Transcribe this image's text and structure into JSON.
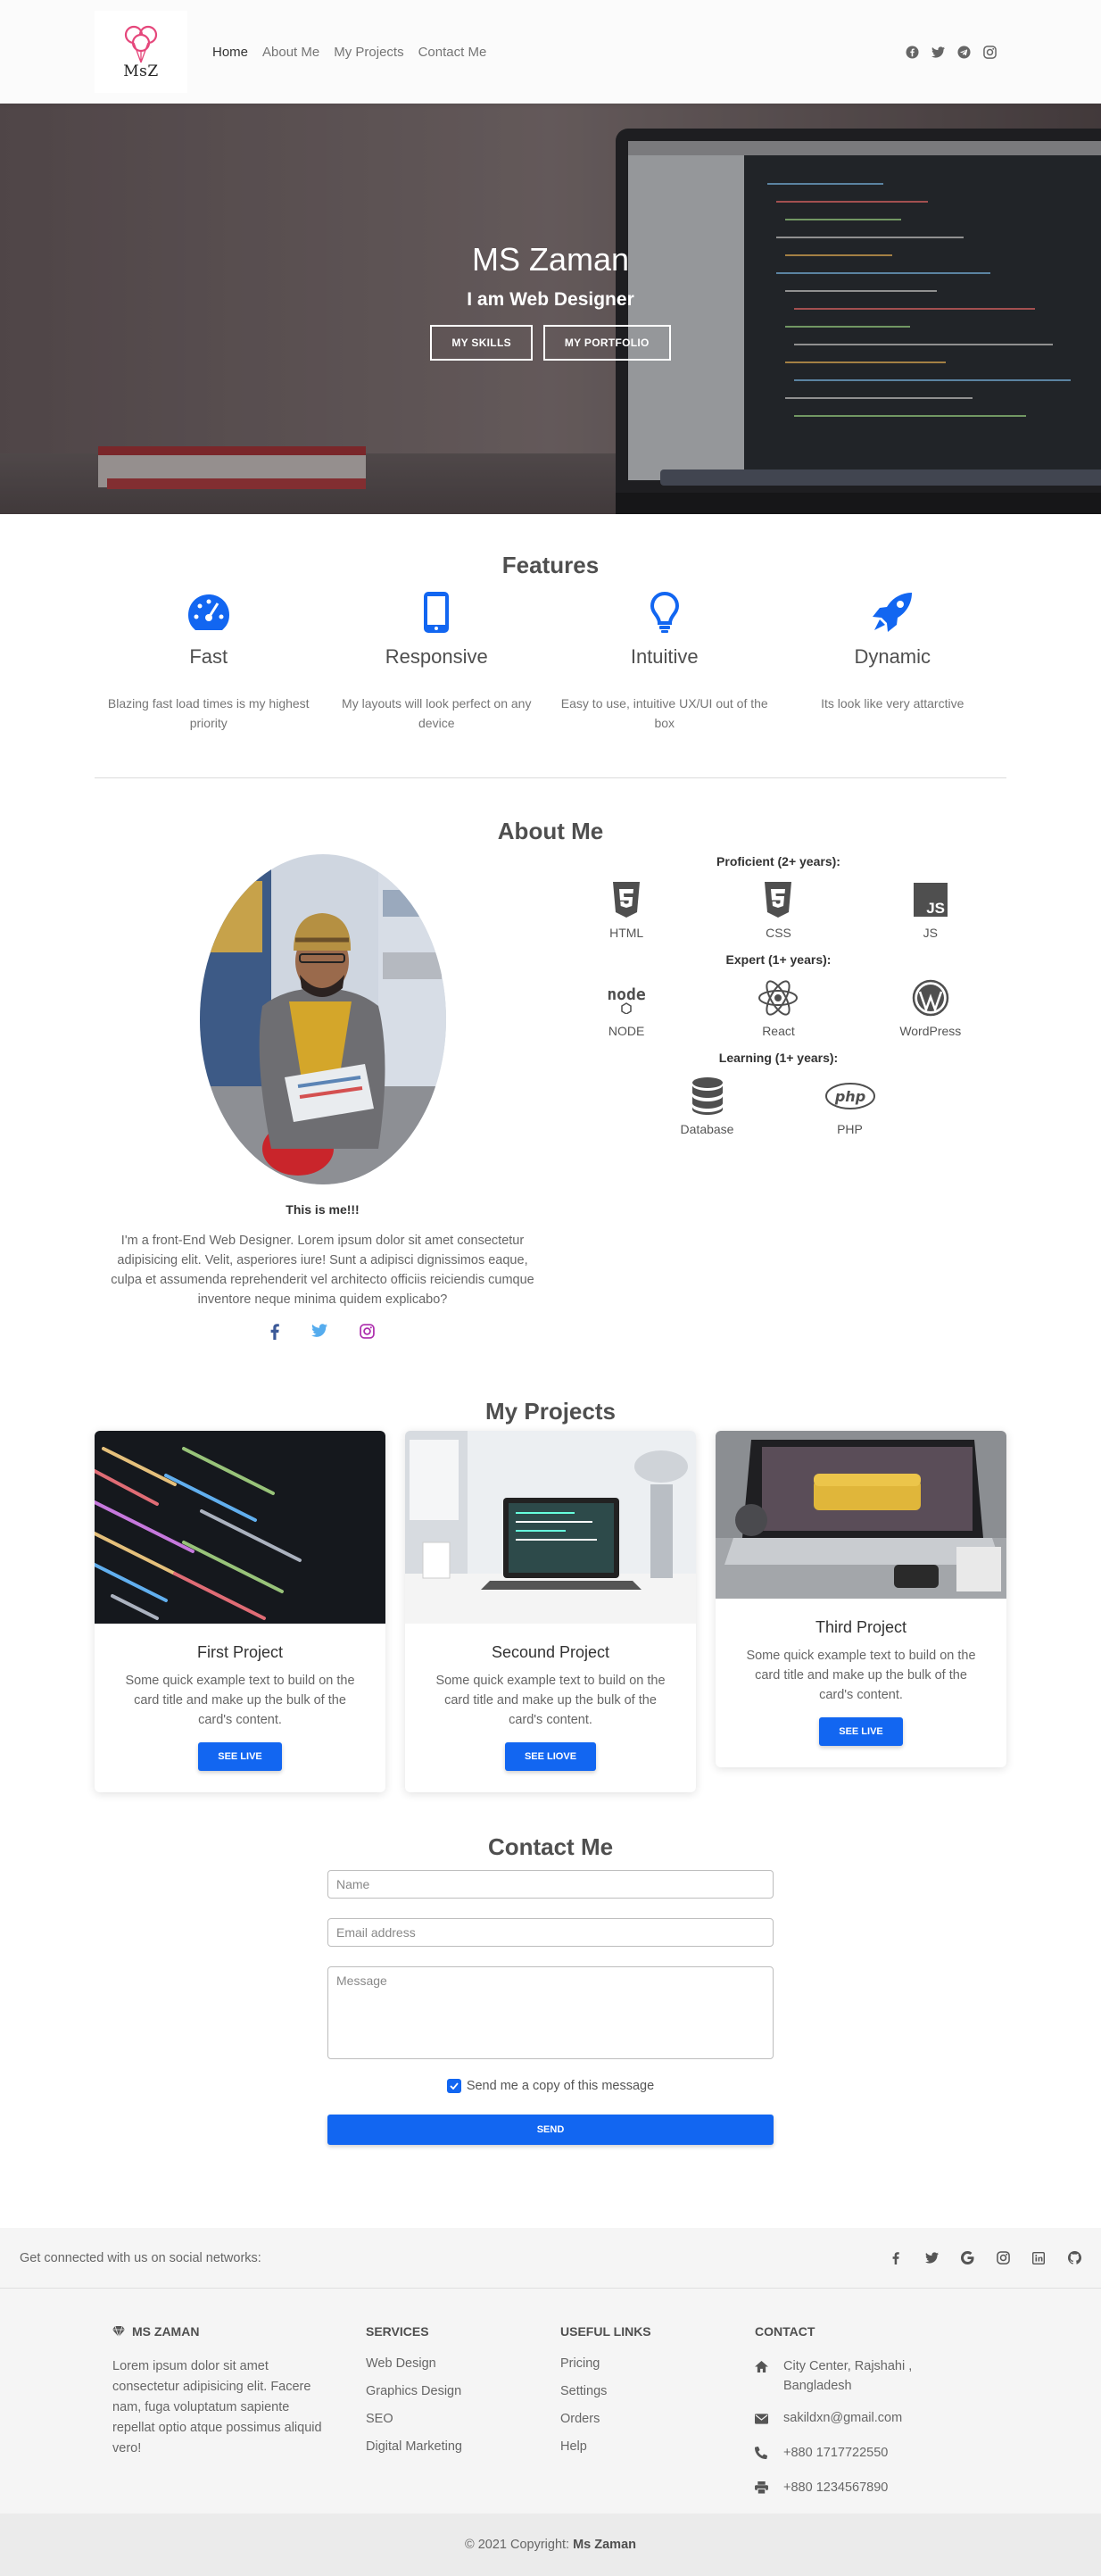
{
  "nav": {
    "logo_text": "MsZ",
    "links": [
      "Home",
      "About Me",
      "My Projects",
      "Contact Me"
    ],
    "social_icons": [
      "facebook-icon",
      "twitter-icon",
      "telegram-icon",
      "instagram-icon"
    ]
  },
  "hero": {
    "title": "MS Zaman",
    "subtitle": "I am Web Designer",
    "btn_skills": "MY SKILLS",
    "btn_portfolio": "MY PORTFOLIO"
  },
  "features": {
    "title": "Features",
    "items": [
      {
        "icon": "speedometer-icon",
        "title": "Fast",
        "text": "Blazing fast load times is my highest priority"
      },
      {
        "icon": "mobile-icon",
        "title": "Responsive",
        "text": "My layouts will look perfect on any device"
      },
      {
        "icon": "lightbulb-icon",
        "title": "Intuitive",
        "text": "Easy to use, intuitive UX/UI out of the box"
      },
      {
        "icon": "rocket-icon",
        "title": "Dynamic",
        "text": "Its look like very attarctive"
      }
    ]
  },
  "about": {
    "title": "About Me",
    "caption": "This is me!!!",
    "text": "I'm a front-End Web Designer. Lorem ipsum dolor sit amet consectetur adipisicing elit. Velit, asperiores iure! Sunt a adipisci dignissimos eaque, culpa et assumenda reprehenderit vel architecto officiis reiciendis cumque inventore neque minima quidem explicabo?",
    "social_icons": [
      "facebook-icon",
      "twitter-icon",
      "instagram-icon"
    ],
    "groups": [
      {
        "label": "Proficient (2+ years):",
        "skills": [
          "HTML",
          "CSS",
          "JS"
        ]
      },
      {
        "label": "Expert (1+ years):",
        "skills": [
          "NODE",
          "React",
          "WordPress"
        ]
      },
      {
        "label": "Learning (1+ years):",
        "skills": [
          "Database",
          "PHP"
        ]
      }
    ]
  },
  "projects": {
    "title": "My Projects",
    "cards": [
      {
        "title": "First Project",
        "text": "Some quick example text to build on the card title and make up the bulk of the card's content.",
        "button": "SEE LIVE"
      },
      {
        "title": "Secound Project",
        "text": "Some quick example text to build on the card title and make up the bulk of the card's content.",
        "button": "SEE LIOVE"
      },
      {
        "title": "Third Project",
        "text": "Some quick example text to build on the card title and make up the bulk of the card's content.",
        "button": "SEE LIVE"
      }
    ]
  },
  "contact": {
    "title": "Contact Me",
    "name_placeholder": "Name",
    "email_placeholder": "Email address",
    "message_placeholder": "Message",
    "copy_label": "Send me a copy of this message",
    "send": "SEND"
  },
  "footer": {
    "social_label": "Get connected with us on social networks:",
    "social_icons": [
      "facebook-icon",
      "twitter-icon",
      "google-icon",
      "instagram-icon",
      "linkedin-icon",
      "github-icon"
    ],
    "brand": "MS ZAMAN",
    "brand_text": "Lorem ipsum dolor sit amet consectetur adipisicing elit. Facere nam, fuga voluptatum sapiente repellat optio atque possimus aliquid vero!",
    "services_title": "SERVICES",
    "services": [
      "Web Design",
      "Graphics Design",
      "SEO",
      "Digital Marketing"
    ],
    "links_title": "USEFUL LINKS",
    "links": [
      "Pricing",
      "Settings",
      "Orders",
      "Help"
    ],
    "contact_title": "CONTACT",
    "address": "City Center, Rajshahi , Bangladesh",
    "email": "sakildxn@gmail.com",
    "phone": "+880 1717722550",
    "fax": "+880 1234567890",
    "copyright_prefix": "© 2021 Copyright:",
    "copyright_name": "Ms Zaman"
  },
  "colors": {
    "primary": "#1266f1",
    "text": "#4f4f4f",
    "muted": "#757575"
  }
}
